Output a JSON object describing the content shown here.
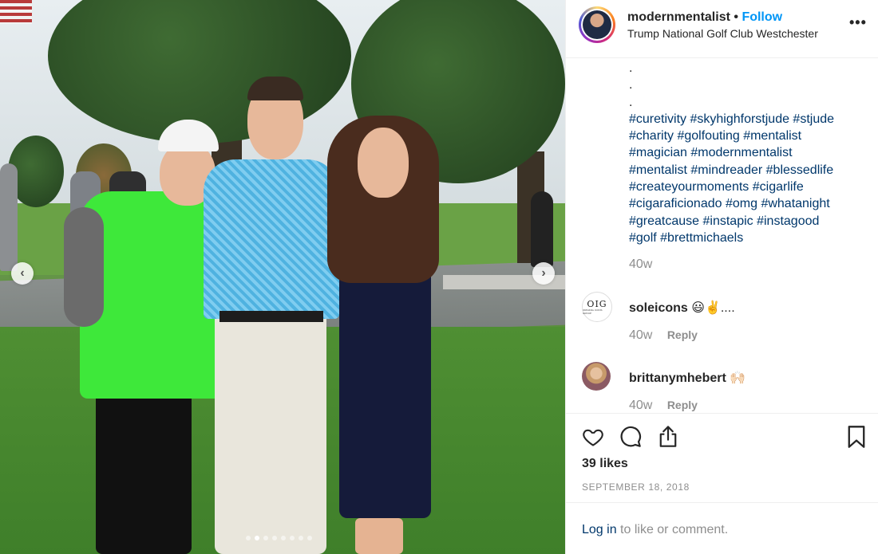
{
  "post": {
    "username": "modernmentalist",
    "separator": "•",
    "follow_label": "Follow",
    "location": "Trump National Golf Club Westchester",
    "more_label": "•••",
    "caption_dots": [
      ".",
      ".",
      "."
    ],
    "hashtag_lines": [
      "#curetivity #skyhighforstjude #stjude",
      "#charity #golfouting #mentalist",
      "#magician #modernmentalist",
      "#mentalist #mindreader #blessedlife",
      "#createyourmoments #cigarlife",
      "#cigaraficionado #omg #whatanight",
      "#greatcause #instapic #instagood",
      "#golf #brettmichaels"
    ],
    "caption_time": "40w",
    "likes": "39 likes",
    "date": "SEPTEMBER 18, 2018",
    "login_link": "Log in",
    "login_rest": " to like or comment."
  },
  "comments": [
    {
      "user": "soleicons",
      "text": " 😃✌️....",
      "time": "40w",
      "reply": "Reply"
    },
    {
      "user": "brittanymhebert",
      "text": " 🙌🏻",
      "time": "40w",
      "reply": "Reply"
    }
  ],
  "avatars": {
    "soleicons_logo": "OIG",
    "soleicons_sub": "ORIGINAL ICONS GROUP"
  },
  "carousel": {
    "prev": "‹",
    "next": "›",
    "count": 8,
    "active_index": 1
  },
  "icons": {
    "like": "heart-icon",
    "comment": "comment-icon",
    "share": "share-icon",
    "save": "bookmark-icon",
    "more": "more-icon"
  },
  "colors": {
    "link": "#00376b",
    "follow": "#0095f6",
    "muted": "#8e8e8e",
    "text": "#262626"
  }
}
